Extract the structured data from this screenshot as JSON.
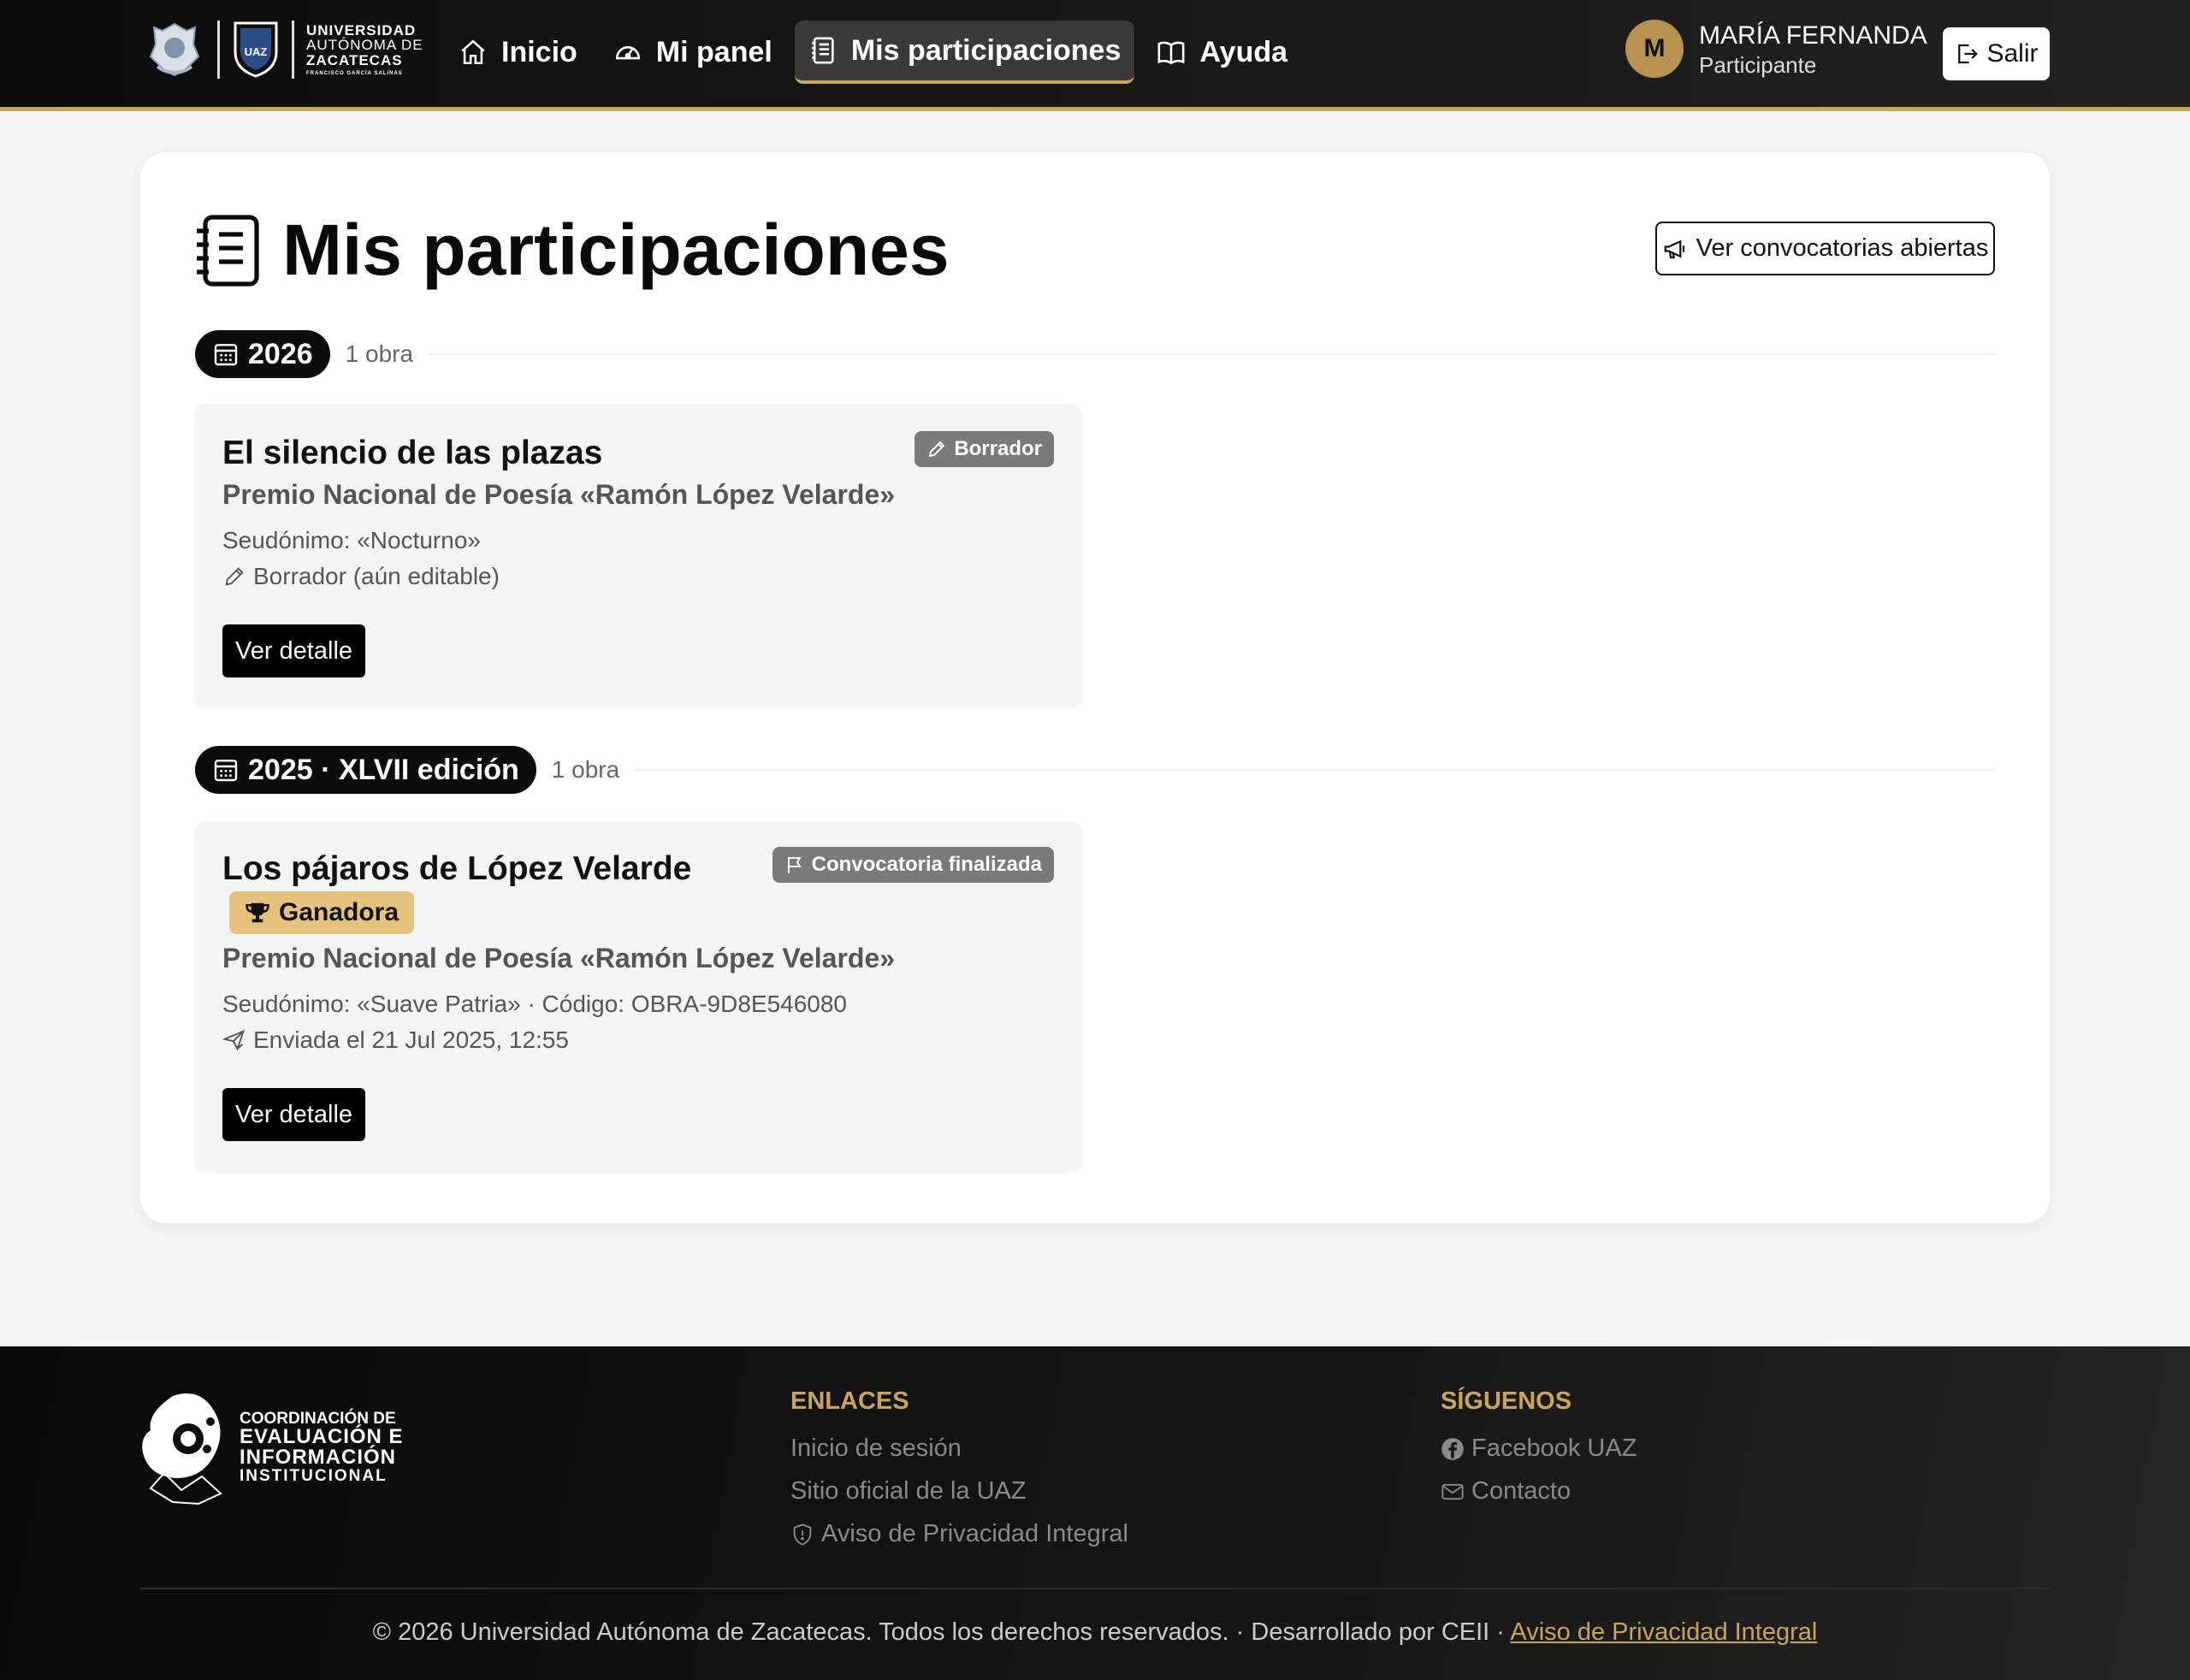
{
  "header": {
    "university": {
      "line1": "UNIVERSIDAD",
      "line2": "AUTÓNOMA DE",
      "line3": "ZACATECAS",
      "line4": "FRANCISCO GARCÍA SALINAS",
      "shield_text": "UAZ"
    },
    "nav": [
      {
        "label": "Inicio",
        "icon": "home-icon"
      },
      {
        "label": "Mi panel",
        "icon": "gauge-icon"
      },
      {
        "label": "Mis participaciones",
        "icon": "list-icon",
        "active": true
      },
      {
        "label": "Ayuda",
        "icon": "book-icon"
      }
    ],
    "user": {
      "initial": "M",
      "name": "MARÍA FERNANDA",
      "role": "Participante"
    },
    "logout_label": "Salir"
  },
  "main": {
    "title": "Mis participaciones",
    "open_calls_label": "Ver convocatorias abiertas",
    "groups": [
      {
        "year_label": "2026",
        "count": "1 obra",
        "works": [
          {
            "title": "El silencio de las plazas",
            "status": "Borrador",
            "contest": "Premio Nacional de Poesía «Ramón López Velarde»",
            "meta1": "Seudónimo: «Nocturno»",
            "meta2": "Borrador (aún editable)",
            "detail_label": "Ver detalle"
          }
        ]
      },
      {
        "year_label": "2025 · XLVII edición",
        "count": "1 obra",
        "works": [
          {
            "title": "Los pájaros de López Velarde",
            "status": "Convocatoria finalizada",
            "award": "Ganadora",
            "contest": "Premio Nacional de Poesía «Ramón López Velarde»",
            "meta1": "Seudónimo: «Suave Patria» · Código: OBRA-9D8E546080",
            "meta2": "Enviada el 21 Jul 2025, 12:55",
            "detail_label": "Ver detalle"
          }
        ]
      }
    ]
  },
  "footer": {
    "logo": {
      "line1": "COORDINACIÓN DE",
      "line2": "EVALUACIÓN E",
      "line3": "INFORMACIÓN",
      "line4": "INSTITUCIONAL"
    },
    "links_heading": "ENLACES",
    "links": [
      "Inicio de sesión",
      "Sitio oficial de la UAZ",
      "Aviso de Privacidad Integral"
    ],
    "follow_heading": "SÍGUENOS",
    "follow": [
      "Facebook UAZ",
      "Contacto"
    ],
    "copyright": "© 2026 Universidad Autónoma de Zacatecas. Todos los derechos reservados. · Desarrollado por CEII ·",
    "privacy_link": "Aviso de Privacidad Integral"
  },
  "colors": {
    "accent_gold": "#c9a55c",
    "badge_gold": "#e6c27e",
    "dark": "#0c0c0c"
  }
}
